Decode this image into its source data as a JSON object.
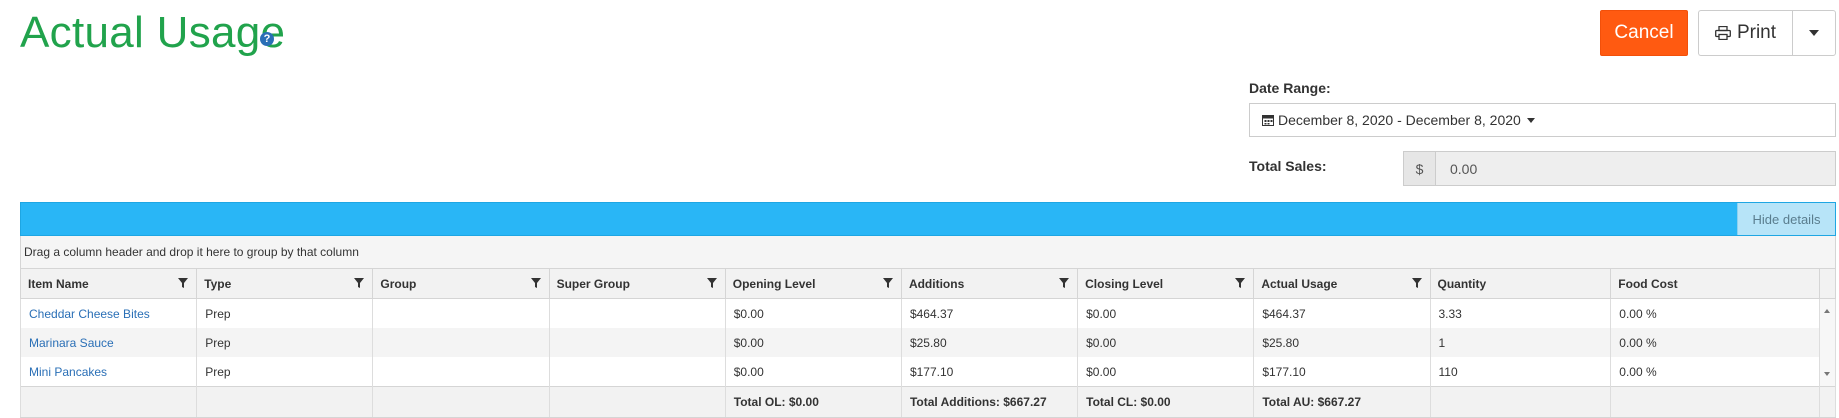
{
  "page": {
    "title": "Actual Usage",
    "help_icon": "question-circle-icon"
  },
  "header_buttons": {
    "cancel": "Cancel",
    "print": "Print"
  },
  "filters": {
    "date_range_label": "Date Range:",
    "date_range_value": "December 8, 2020 - December 8, 2020",
    "total_sales_label": "Total Sales:",
    "total_sales_prefix": "$",
    "total_sales_value": "0.00"
  },
  "grid": {
    "hide_details": "Hide details",
    "group_hint": "Drag a column header and drop it here to group by that column",
    "columns": [
      "Item Name",
      "Type",
      "Group",
      "Super Group",
      "Opening Level",
      "Additions",
      "Closing Level",
      "Actual Usage",
      "Quantity",
      "Food Cost"
    ],
    "rows": [
      {
        "item_name": "Cheddar Cheese Bites",
        "type": "Prep",
        "group": "",
        "super_group": "",
        "opening_level": "$0.00",
        "additions": "$464.37",
        "closing_level": "$0.00",
        "actual_usage": "$464.37",
        "quantity": "3.33",
        "food_cost": "0.00 %"
      },
      {
        "item_name": "Marinara Sauce",
        "type": "Prep",
        "group": "",
        "super_group": "",
        "opening_level": "$0.00",
        "additions": "$25.80",
        "closing_level": "$0.00",
        "actual_usage": "$25.80",
        "quantity": "1",
        "food_cost": "0.00 %"
      },
      {
        "item_name": "Mini Pancakes",
        "type": "Prep",
        "group": "",
        "super_group": "",
        "opening_level": "$0.00",
        "additions": "$177.10",
        "closing_level": "$0.00",
        "actual_usage": "$177.10",
        "quantity": "110",
        "food_cost": "0.00 %"
      }
    ],
    "footer": {
      "opening_level": "Total OL: $0.00",
      "additions": "Total Additions: $667.27",
      "closing_level": "Total CL: $0.00",
      "actual_usage": "Total AU: $667.27"
    }
  },
  "colors": {
    "title": "#21a34c",
    "cancel": "#ff5a11",
    "toolbar": "#29b6f6",
    "link": "#2a6fb6"
  }
}
